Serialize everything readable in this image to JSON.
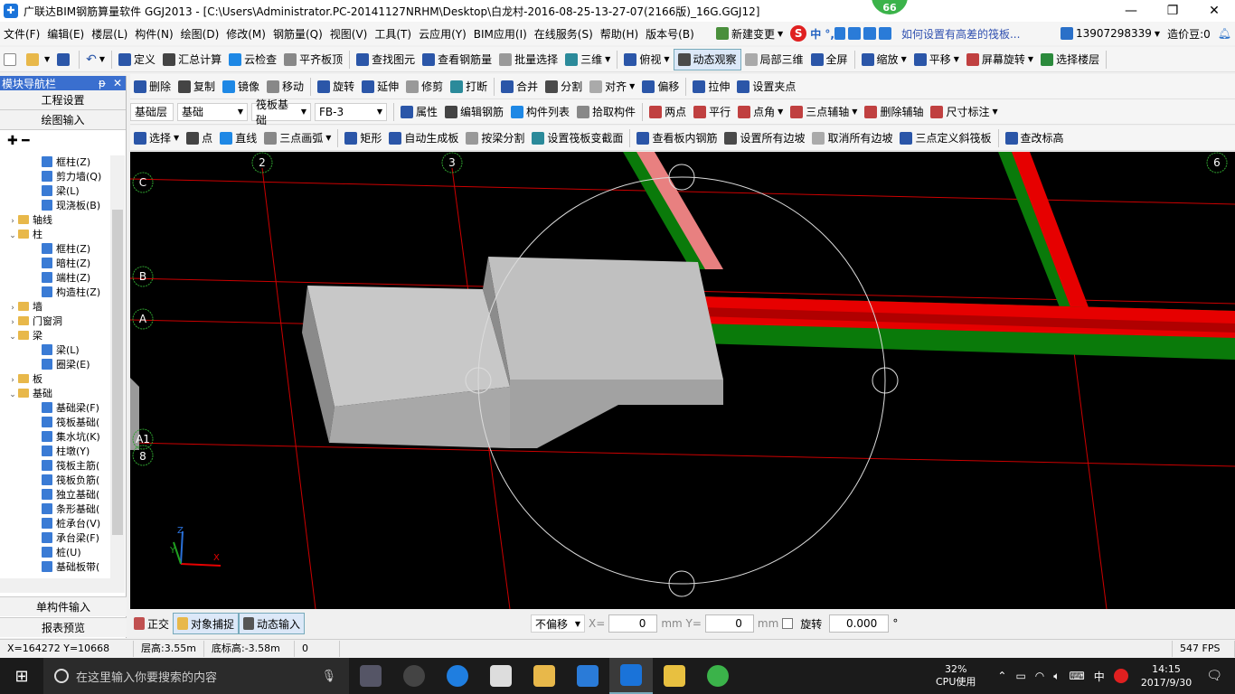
{
  "window": {
    "title": "广联达BIM钢筋算量软件 GGJ2013 - [C:\\Users\\Administrator.PC-20141127NRHM\\Desktop\\白龙村-2016-08-25-13-27-07(2166版)_16G.GGJ12]",
    "badge": "66",
    "min": "—",
    "max": "❐",
    "close": "✕"
  },
  "menu": {
    "items": [
      "文件(F)",
      "编辑(E)",
      "楼层(L)",
      "构件(N)",
      "绘图(D)",
      "修改(M)",
      "钢筋量(Q)",
      "视图(V)",
      "工具(T)",
      "云应用(Y)",
      "BIM应用(I)",
      "在线服务(S)",
      "帮助(H)",
      "版本号(B)"
    ],
    "new_change": "新建变更",
    "ime": "中 °, ",
    "hint": "如何设置有高差的筏板...",
    "phone": "13907298339",
    "beans": "造价豆:0"
  },
  "toolbar1": [
    "定义",
    "汇总计算",
    "云检查",
    "平齐板顶",
    "查找图元",
    "查看钢筋量",
    "批量选择",
    "三维",
    "俯视",
    "动态观察",
    "局部三维",
    "全屏",
    "缩放",
    "平移",
    "屏幕旋转",
    "选择楼层"
  ],
  "toolbar2": [
    "删除",
    "复制",
    "镜像",
    "移动",
    "旋转",
    "延伸",
    "修剪",
    "打断",
    "合并",
    "分割",
    "对齐",
    "偏移",
    "拉伸",
    "设置夹点"
  ],
  "toolbar3": {
    "floor": "基础层",
    "floor_type": "基础",
    "category": "筏板基础",
    "item": "FB-3",
    "buttons": [
      "属性",
      "编辑钢筋",
      "构件列表",
      "拾取构件"
    ],
    "axis_tools": [
      "两点",
      "平行",
      "点角",
      "三点辅轴",
      "删除辅轴",
      "尺寸标注"
    ]
  },
  "toolbar4": [
    "选择",
    "点",
    "直线",
    "三点画弧",
    "矩形",
    "自动生成板",
    "按梁分割",
    "设置筏板变截面",
    "查看板内钢筋",
    "设置所有边坡",
    "取消所有边坡",
    "三点定义斜筏板",
    "查改标高"
  ],
  "sidebar": {
    "title": "模块导航栏",
    "pin": "ᵽ",
    "close": "✕",
    "top_buttons": [
      "工程设置",
      "绘图输入"
    ],
    "tools": "✚ ━",
    "tree": [
      {
        "label": "框柱(Z)",
        "level": 2,
        "type": "leaf"
      },
      {
        "label": "剪力墙(Q)",
        "level": 2,
        "type": "leaf"
      },
      {
        "label": "梁(L)",
        "level": 2,
        "type": "leaf"
      },
      {
        "label": "现浇板(B)",
        "level": 2,
        "type": "leaf"
      },
      {
        "label": "轴线",
        "level": 1,
        "type": "folder",
        "exp": "›"
      },
      {
        "label": "柱",
        "level": 1,
        "type": "folder",
        "exp": "⌄"
      },
      {
        "label": "框柱(Z)",
        "level": 2,
        "type": "leaf"
      },
      {
        "label": "暗柱(Z)",
        "level": 2,
        "type": "leaf"
      },
      {
        "label": "端柱(Z)",
        "level": 2,
        "type": "leaf"
      },
      {
        "label": "构造柱(Z)",
        "level": 2,
        "type": "leaf"
      },
      {
        "label": "墙",
        "level": 1,
        "type": "folder",
        "exp": "›"
      },
      {
        "label": "门窗洞",
        "level": 1,
        "type": "folder",
        "exp": "›"
      },
      {
        "label": "梁",
        "level": 1,
        "type": "folder",
        "exp": "⌄"
      },
      {
        "label": "梁(L)",
        "level": 2,
        "type": "leaf"
      },
      {
        "label": "圈梁(E)",
        "level": 2,
        "type": "leaf"
      },
      {
        "label": "板",
        "level": 1,
        "type": "folder",
        "exp": "›"
      },
      {
        "label": "基础",
        "level": 1,
        "type": "folder",
        "exp": "⌄"
      },
      {
        "label": "基础梁(F)",
        "level": 2,
        "type": "leaf"
      },
      {
        "label": "筏板基础(",
        "level": 2,
        "type": "leaf"
      },
      {
        "label": "集水坑(K)",
        "level": 2,
        "type": "leaf"
      },
      {
        "label": "柱墩(Y)",
        "level": 2,
        "type": "leaf"
      },
      {
        "label": "筏板主筋(",
        "level": 2,
        "type": "leaf"
      },
      {
        "label": "筏板负筋(",
        "level": 2,
        "type": "leaf"
      },
      {
        "label": "独立基础(",
        "level": 2,
        "type": "leaf"
      },
      {
        "label": "条形基础(",
        "level": 2,
        "type": "leaf"
      },
      {
        "label": "桩承台(V)",
        "level": 2,
        "type": "leaf"
      },
      {
        "label": "承台梁(F)",
        "level": 2,
        "type": "leaf"
      },
      {
        "label": "桩(U)",
        "level": 2,
        "type": "leaf"
      },
      {
        "label": "基础板带(",
        "level": 2,
        "type": "leaf"
      }
    ],
    "bottom_buttons": [
      "单构件输入",
      "报表预览"
    ]
  },
  "viewport": {
    "axis_labels": [
      "2",
      "3",
      "6",
      "C",
      "B",
      "A",
      "A1",
      "8"
    ],
    "axes": {
      "x": "X",
      "y": "Y",
      "z": "Z"
    }
  },
  "bottombar": {
    "ortho": "正交",
    "snap": "对象捕捉",
    "dynamic": "动态输入",
    "offset": "不偏移",
    "x_label": "X=",
    "x_value": "0",
    "y_label": "mm Y=",
    "y_value": "0",
    "mm": "mm",
    "rotate": "旋转",
    "rotate_value": "0.000",
    "deg": "°"
  },
  "status": {
    "coords": "X=164272 Y=10668",
    "floor_height": "层高:3.55m",
    "bottom_elev": "底标高:-3.58m",
    "zero": "0",
    "fps": "547 FPS"
  },
  "taskbar": {
    "search_placeholder": "在这里输入你要搜索的内容",
    "cpu": "32%",
    "cpu_label": "CPU使用",
    "ime": "中",
    "time": "14:15",
    "date": "2017/9/30"
  },
  "colors": {
    "beam_red": "#e60000",
    "beam_green": "#0a7a0a",
    "grid_red": "#cc0000",
    "slab_gray": "#b4b4b4",
    "nav_blue": "#3a6fcf"
  }
}
